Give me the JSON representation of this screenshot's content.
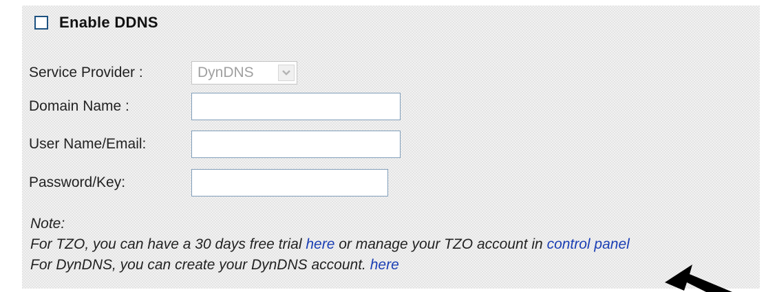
{
  "enable_ddns": {
    "label": "Enable DDNS",
    "checked": false
  },
  "fields": {
    "service_provider": {
      "label": "Service Provider :",
      "value": "DynDNS"
    },
    "domain_name": {
      "label": "Domain Name :",
      "value": ""
    },
    "user_name": {
      "label": "User Name/Email:",
      "value": ""
    },
    "password": {
      "label": "Password/Key:",
      "value": ""
    }
  },
  "note": {
    "title": "Note:",
    "tzo_prefix": "For TZO, you can have a 30 days free trial",
    "tzo_here": "here",
    "tzo_middle": "or manage your TZO account in",
    "tzo_control_panel": "control panel",
    "dyndns_prefix": "For DynDNS, you can create your DynDNS account.",
    "dyndns_here": "here"
  },
  "colors": {
    "link": "#1a3eb4",
    "checkbox_border": "#1c5180",
    "input_border": "#7f9db9"
  },
  "icons": {
    "dropdown": "chevron-down-icon",
    "pointer": "arrow-pointer-icon"
  }
}
